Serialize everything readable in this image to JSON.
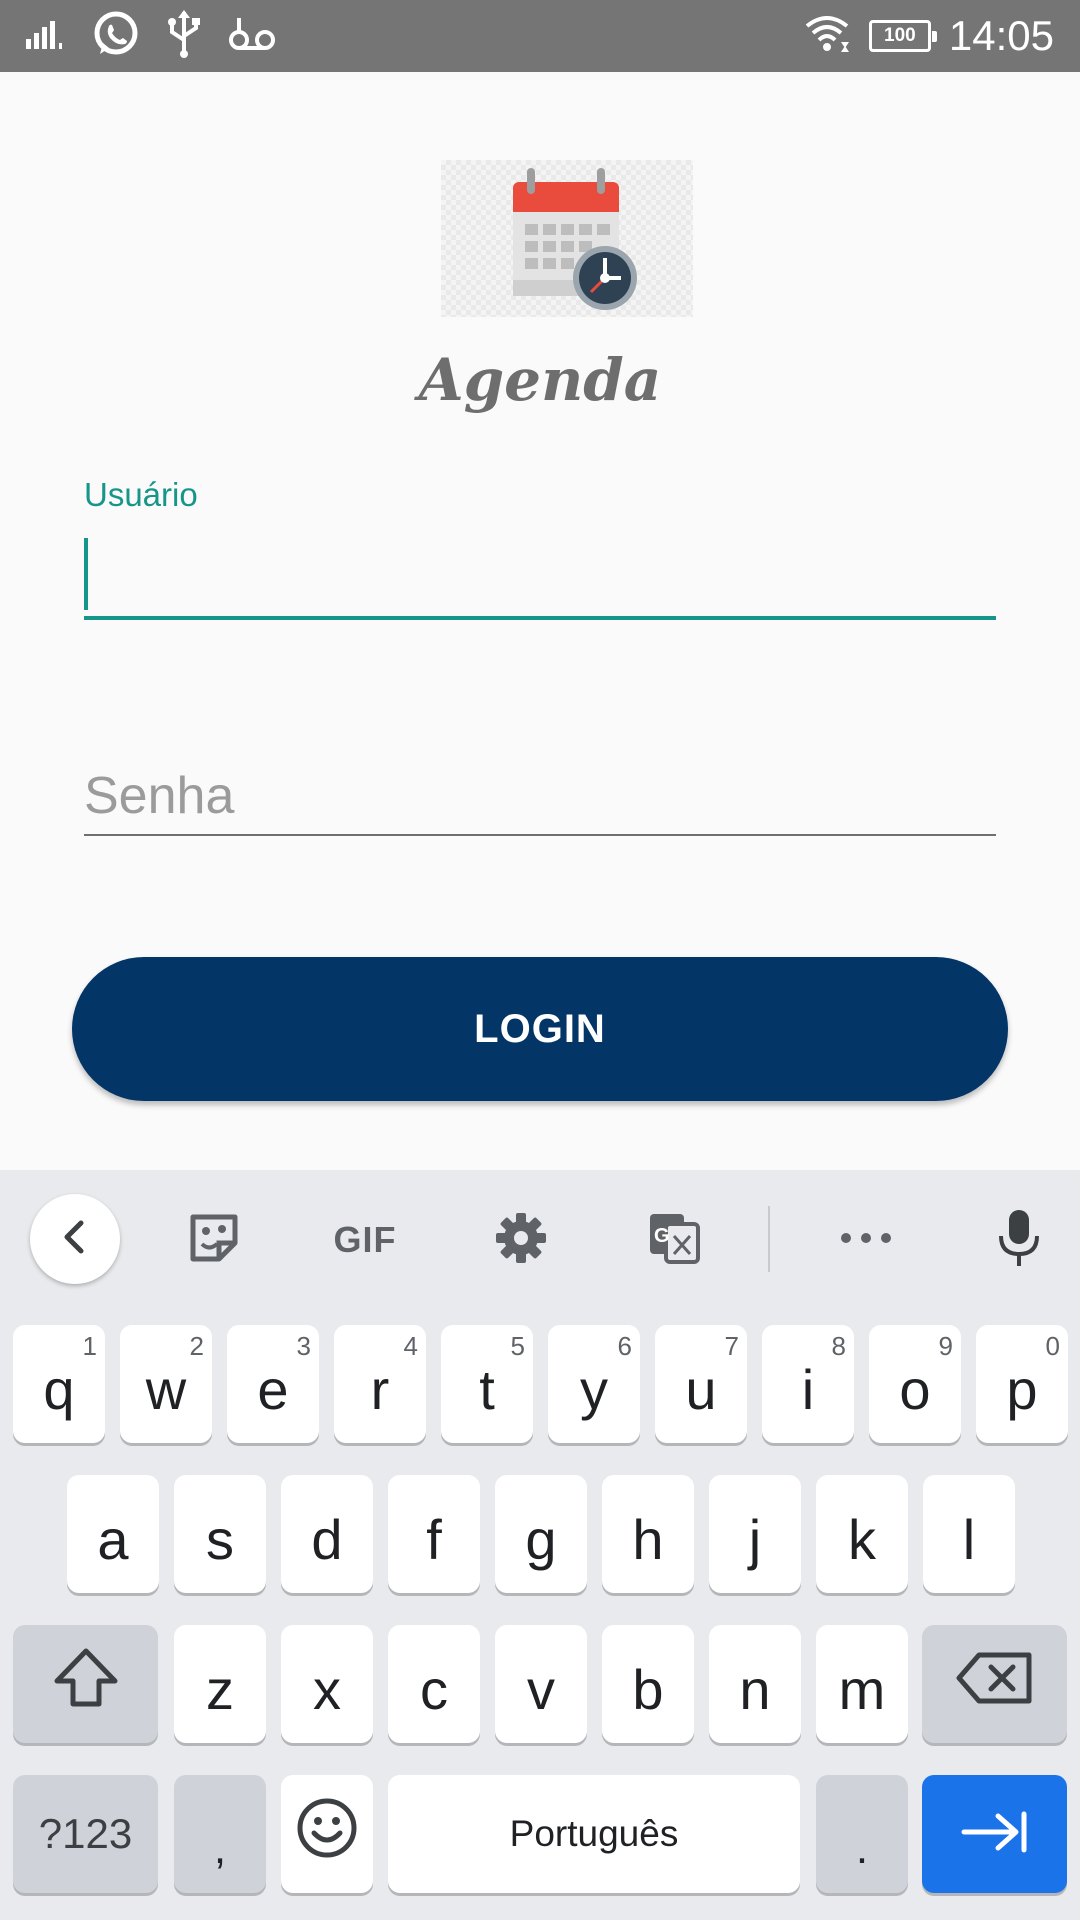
{
  "status_bar": {
    "time": "14:05",
    "battery": "100",
    "icons": [
      "signal-icon",
      "whatsapp-icon",
      "usb-icon",
      "voicemail-icon",
      "wifi-icon",
      "battery-icon"
    ]
  },
  "app": {
    "title": "Agenda",
    "logo": "calendar-clock-logo",
    "username_label": "Usuário",
    "username_value": "",
    "password_placeholder": "Senha",
    "login_label": "LOGIN",
    "accent_color": "#16968a",
    "button_color": "#033567"
  },
  "keyboard": {
    "toolbar": {
      "gif_label": "GIF",
      "icons": [
        "back-chevron-icon",
        "sticker-icon",
        "gif-icon",
        "settings-icon",
        "translate-icon",
        "more-icon",
        "microphone-icon"
      ]
    },
    "row1": [
      {
        "key": "q",
        "hint": "1"
      },
      {
        "key": "w",
        "hint": "2"
      },
      {
        "key": "e",
        "hint": "3"
      },
      {
        "key": "r",
        "hint": "4"
      },
      {
        "key": "t",
        "hint": "5"
      },
      {
        "key": "y",
        "hint": "6"
      },
      {
        "key": "u",
        "hint": "7"
      },
      {
        "key": "i",
        "hint": "8"
      },
      {
        "key": "o",
        "hint": "9"
      },
      {
        "key": "p",
        "hint": "0"
      }
    ],
    "row2": [
      "a",
      "s",
      "d",
      "f",
      "g",
      "h",
      "j",
      "k",
      "l"
    ],
    "row3": [
      "z",
      "x",
      "c",
      "v",
      "b",
      "n",
      "m"
    ],
    "row4": {
      "symbols": "?123",
      "comma": ",",
      "space": "Português",
      "period": "."
    },
    "enter_color": "#1a73e8"
  }
}
